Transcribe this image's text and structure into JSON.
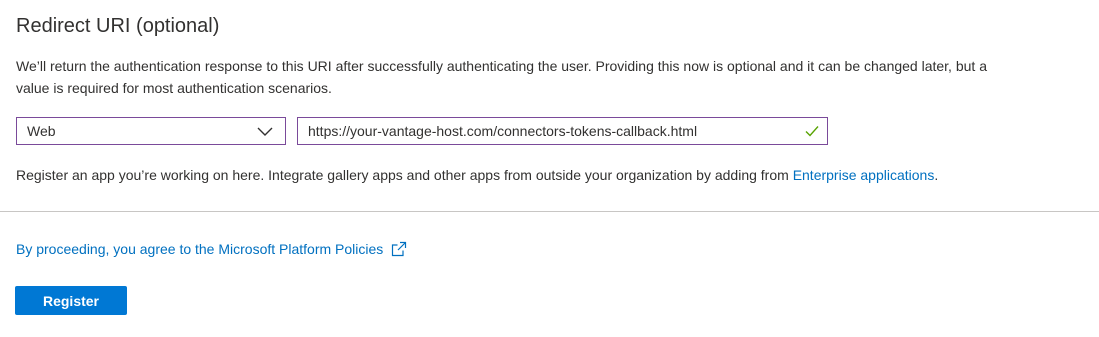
{
  "section": {
    "title": "Redirect URI (optional)",
    "description": "We’ll return the authentication response to this URI after successfully authenticating the user. Providing this now is optional and it can be changed later, but a value is required for most authentication scenarios."
  },
  "platform_select": {
    "value": "Web",
    "icon": "chevron-down-icon"
  },
  "redirect_uri": {
    "value": "https://your-vantage-host.com/connectors-tokens-callback.html",
    "valid_icon": "checkmark-icon",
    "valid_color": "#57a300"
  },
  "help": {
    "text": "Register an app you’re working on here. Integrate gallery apps and other apps from outside your organization by adding from ",
    "link_label": "Enterprise applications",
    "suffix": "."
  },
  "policy": {
    "link_label": "By proceeding, you agree to the Microsoft Platform Policies",
    "icon": "external-link-icon"
  },
  "actions": {
    "register_label": "Register"
  },
  "colors": {
    "accent": "#0078d4",
    "link": "#0070c0",
    "focus_border": "#7a4a9a"
  }
}
